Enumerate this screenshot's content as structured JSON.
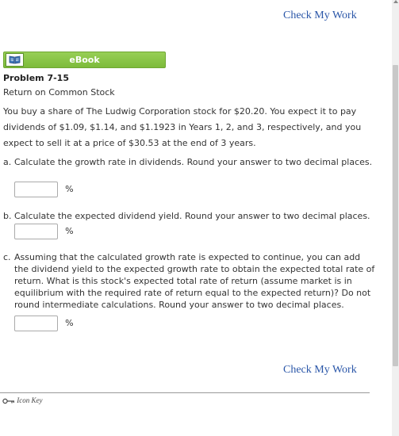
{
  "header": {
    "check_my_work": "Check My Work"
  },
  "ebook": {
    "label": "eBook",
    "icon": "book-icon"
  },
  "problem": {
    "title": "Problem 7-15",
    "subtitle": "Return on Common Stock",
    "text": "You buy a share of The Ludwig Corporation stock for $20.20. You expect it to pay dividends of $1.09, $1.14, and $1.1923 in Years 1, 2, and 3, respectively, and you expect to sell it at a price of $30.53 at the end of 3 years."
  },
  "questions": [
    {
      "letter": "a.",
      "text": "Calculate the growth rate in dividends. Round your answer to two decimal places.",
      "value": "",
      "unit": "%"
    },
    {
      "letter": "b.",
      "text": "Calculate the expected dividend yield. Round your answer to two decimal places.",
      "value": "",
      "unit": "%"
    },
    {
      "letter": "c.",
      "text": "Assuming that the calculated growth rate is expected to continue, you can add the dividend yield to the expected growth rate to obtain the expected total rate of return. What is this stock's expected total rate of return (assume market is in equilibrium with the required rate of return equal to the expected return)? Do not round intermediate calculations. Round your answer to two decimal places.",
      "value": "",
      "unit": "%"
    }
  ],
  "footer": {
    "check_my_work": "Check My Work",
    "icon_key": "Icon Key",
    "icon_key_icon": "key-icon"
  },
  "colors": {
    "link": "#2a56a8",
    "ebook_green": "#88c444"
  }
}
